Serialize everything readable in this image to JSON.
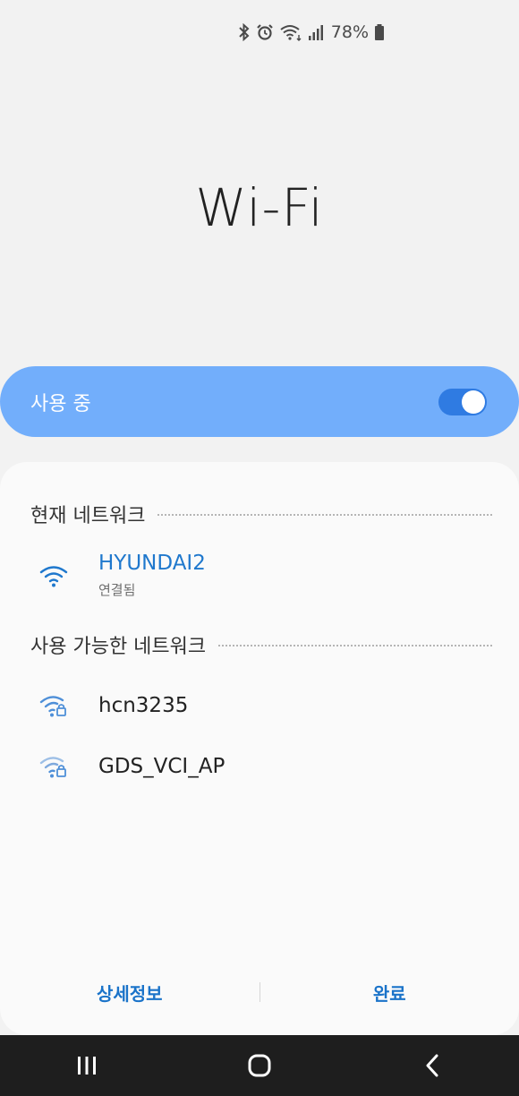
{
  "status_bar": {
    "battery_percent": "78%",
    "icons": [
      "bluetooth-icon",
      "alarm-icon",
      "wifi-icon",
      "signal-icon",
      "battery-icon"
    ]
  },
  "title": "Wi-Fi",
  "toggle": {
    "label": "사용 중",
    "on": true
  },
  "current_network": {
    "header": "현재 네트워크",
    "name": "HYUNDAI2",
    "status": "연결됨"
  },
  "available_networks": {
    "header": "사용 가능한 네트워크",
    "items": [
      {
        "name": "hcn3235",
        "secured": true
      },
      {
        "name": "GDS_VCI_AP",
        "secured": true
      }
    ]
  },
  "buttons": {
    "details_label": "상세정보",
    "done_label": "완료"
  },
  "colors": {
    "accent": "#1f78cd",
    "toggle_bar": "#72aefb",
    "toggle_track": "#2f7be2"
  }
}
